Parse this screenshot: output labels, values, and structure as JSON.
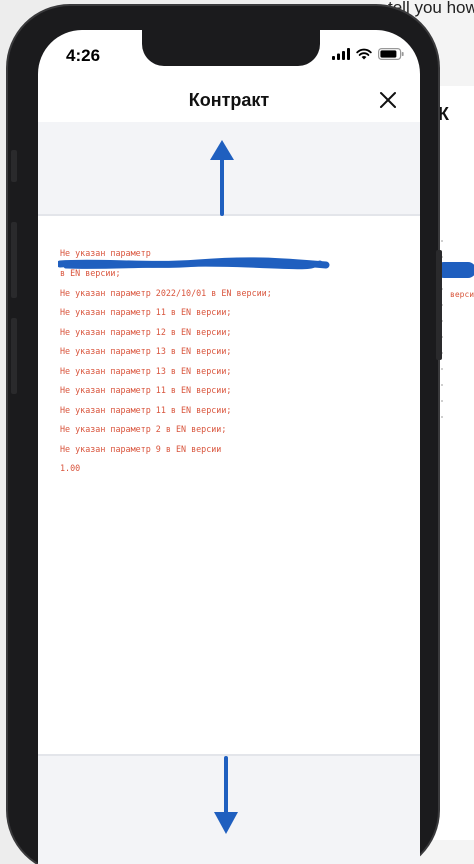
{
  "background": {
    "top_text": "tell you how",
    "right_header_letter": "К",
    "right_snippet": "версии"
  },
  "status_bar": {
    "time": "4:26"
  },
  "header": {
    "title": "Контракт"
  },
  "document": {
    "lines": [
      "Не указан параметр",
      "                           в EN версии;",
      "Не указан параметр 2022/10/01 в EN версии;",
      "Не указан параметр 11 в EN версии;",
      "Не указан параметр 12 в EN версии;",
      "Не указан параметр 13 в EN версии;",
      "Не указан параметр 13 в EN версии;",
      "Не указан параметр 11 в EN версии;",
      "Не указан параметр 11 в EN версии;",
      "Не указан параметр 2 в EN версии;",
      "Не указан параметр 9 в EN версии",
      "1.00"
    ]
  },
  "colors": {
    "error_text": "#d9553d",
    "annotation_blue": "#1f5fbf",
    "sheet_gray": "#f3f4f7"
  },
  "icons": {
    "signal": "cellular-signal-icon",
    "wifi": "wifi-icon",
    "battery": "battery-icon",
    "close": "close-icon",
    "arrow_up": "arrow-up-icon",
    "arrow_down": "arrow-down-icon"
  }
}
